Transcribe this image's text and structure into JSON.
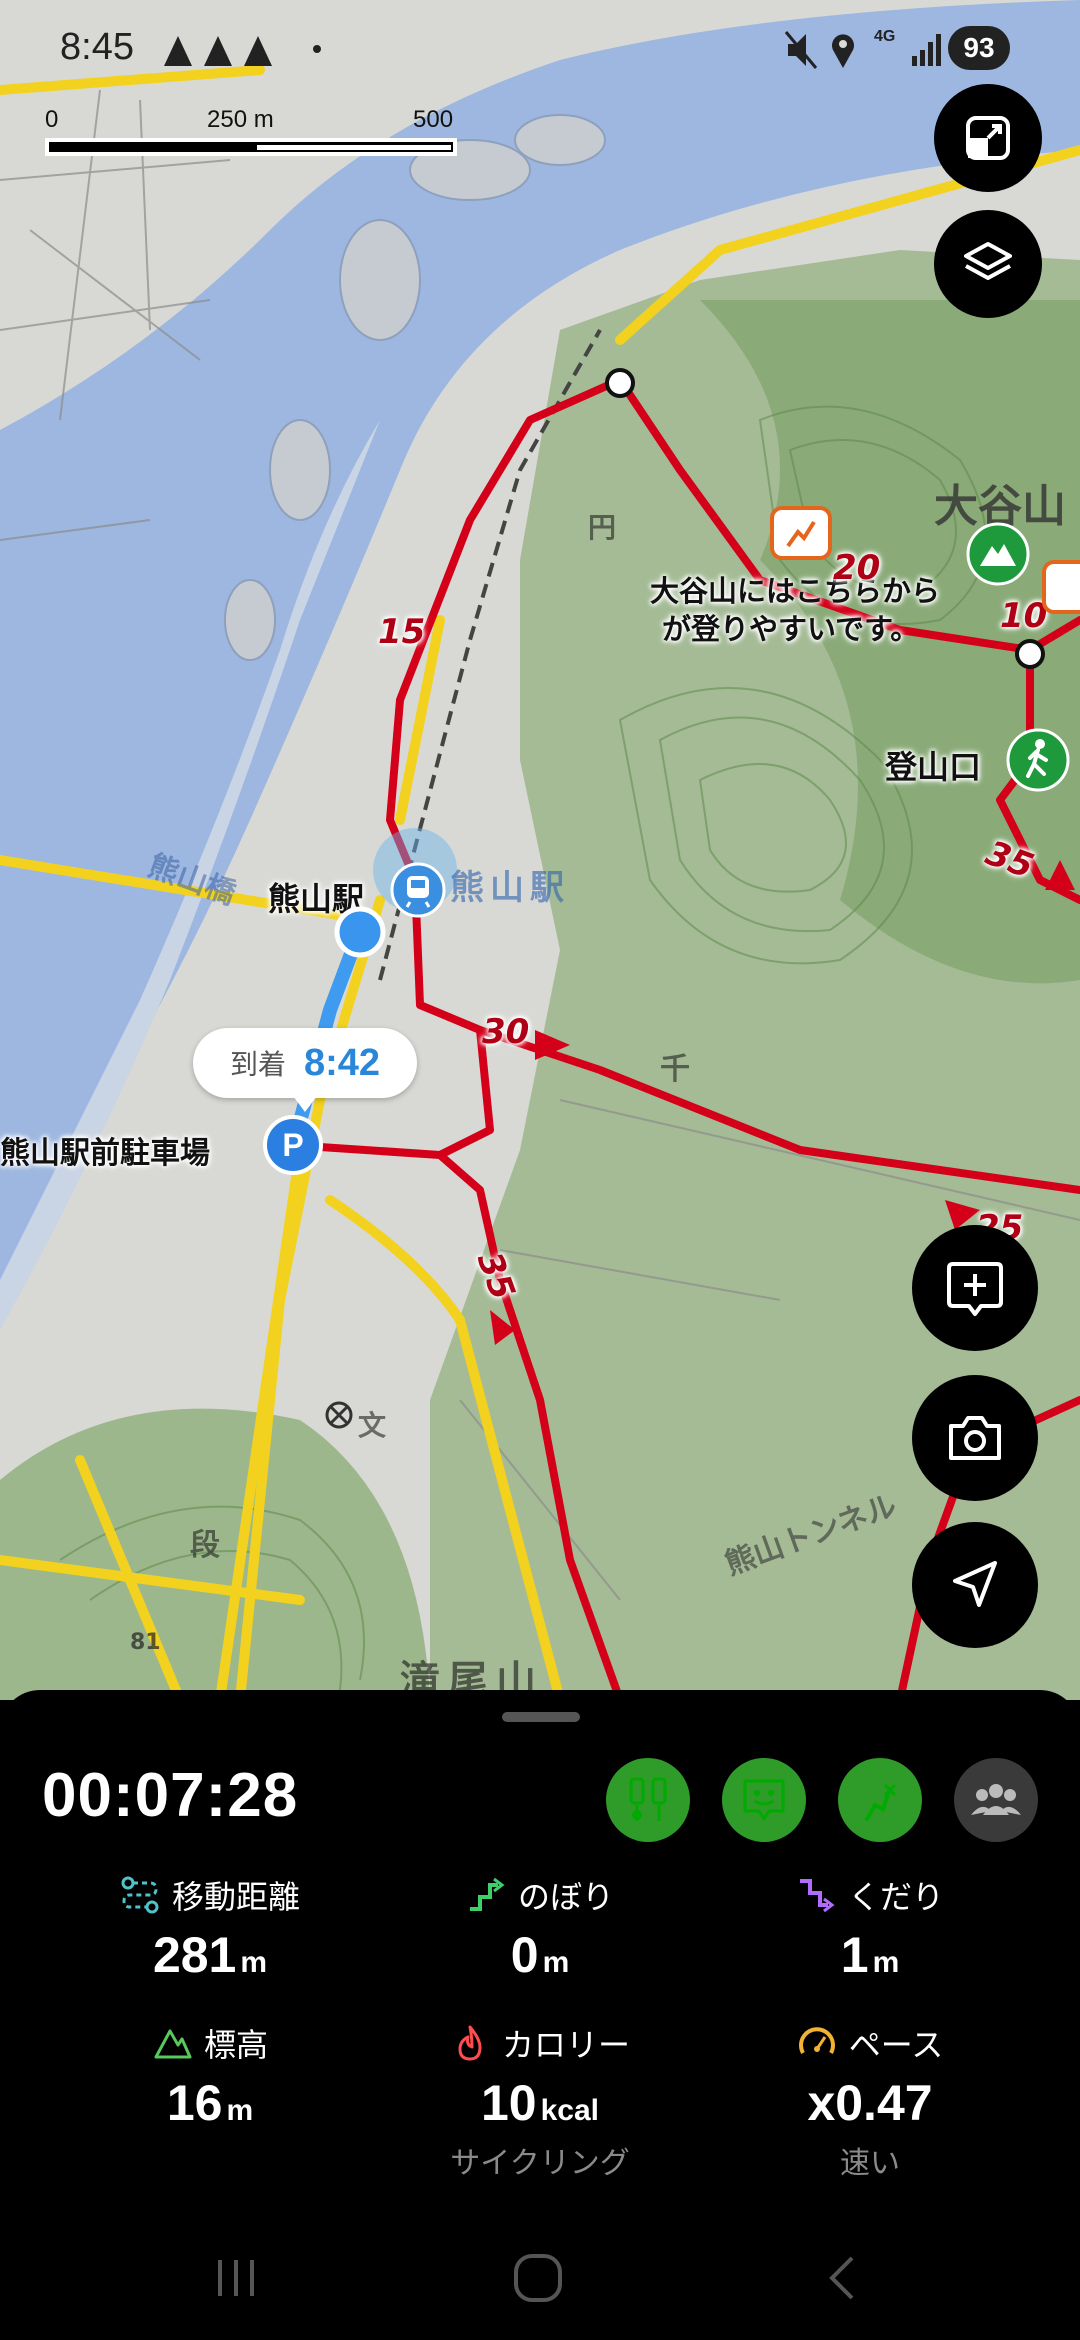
{
  "status_bar": {
    "time": "8:45",
    "battery": "93",
    "network": "4G",
    "icons": [
      "mountain-icon",
      "mountain-icon",
      "mountain-icon",
      "dot-icon",
      "mute-icon",
      "location-icon",
      "network-4g-icon",
      "signal-icon",
      "battery-icon"
    ]
  },
  "scale": {
    "labels": [
      "0",
      "250 m",
      "500 m"
    ]
  },
  "map": {
    "labels": {
      "station": "熊山駅",
      "station_map": "熊山駅",
      "parking": "熊山駅前駐車場",
      "trailhead": "登山口",
      "note_line1": "大谷山にはこちらから",
      "note_line2": "が登りやすいです。",
      "mountain_kanji": "大谷山",
      "river_name": "熊山橋",
      "tunnel": "熊山トンネル",
      "peak": "滝尾山",
      "step": "段",
      "school": "文",
      "chi": "千",
      "shrine": "円",
      "num_81": "81"
    },
    "route_numbers": [
      "15",
      "20",
      "10",
      "35",
      "30",
      "25",
      "35"
    ],
    "colors": {
      "route": "#d4001a",
      "road": "#f2d21f",
      "water": "#9bb7e2",
      "forest": "#7fa86a"
    }
  },
  "arrival": {
    "label": "到着",
    "time": "8:42"
  },
  "buttons": {
    "expand": "expand-icon",
    "layers": "layers-icon",
    "add_memo": "add-memo-icon",
    "camera": "camera-icon",
    "navigate": "navigate-icon"
  },
  "panel": {
    "elapsed": "00:07:28",
    "actions": [
      "gear-icon",
      "emoji-icon",
      "route-icon",
      "group-icon"
    ],
    "stats": [
      {
        "label": "移動距離",
        "value": "281",
        "unit": "m",
        "sub": "",
        "icon": "distance-icon",
        "color": "#4fc3c8"
      },
      {
        "label": "のぼり",
        "value": "0",
        "unit": "m",
        "sub": "",
        "icon": "ascent-icon",
        "color": "#3ecf6a"
      },
      {
        "label": "くだり",
        "value": "1",
        "unit": "m",
        "sub": "",
        "icon": "descent-icon",
        "color": "#b06cff"
      },
      {
        "label": "標高",
        "value": "16",
        "unit": "m",
        "sub": "",
        "icon": "elevation-icon",
        "color": "#58c95a"
      },
      {
        "label": "カロリー",
        "value": "10",
        "unit": "kcal",
        "sub": "サイクリング",
        "icon": "flame-icon",
        "color": "#ff4d4d"
      },
      {
        "label": "ペース",
        "value": "x0.47",
        "unit": "",
        "sub": "速い",
        "icon": "speedometer-icon",
        "color": "#f2b233"
      }
    ]
  },
  "navbar": {
    "buttons": [
      "recents-icon",
      "home-icon",
      "back-icon"
    ]
  }
}
